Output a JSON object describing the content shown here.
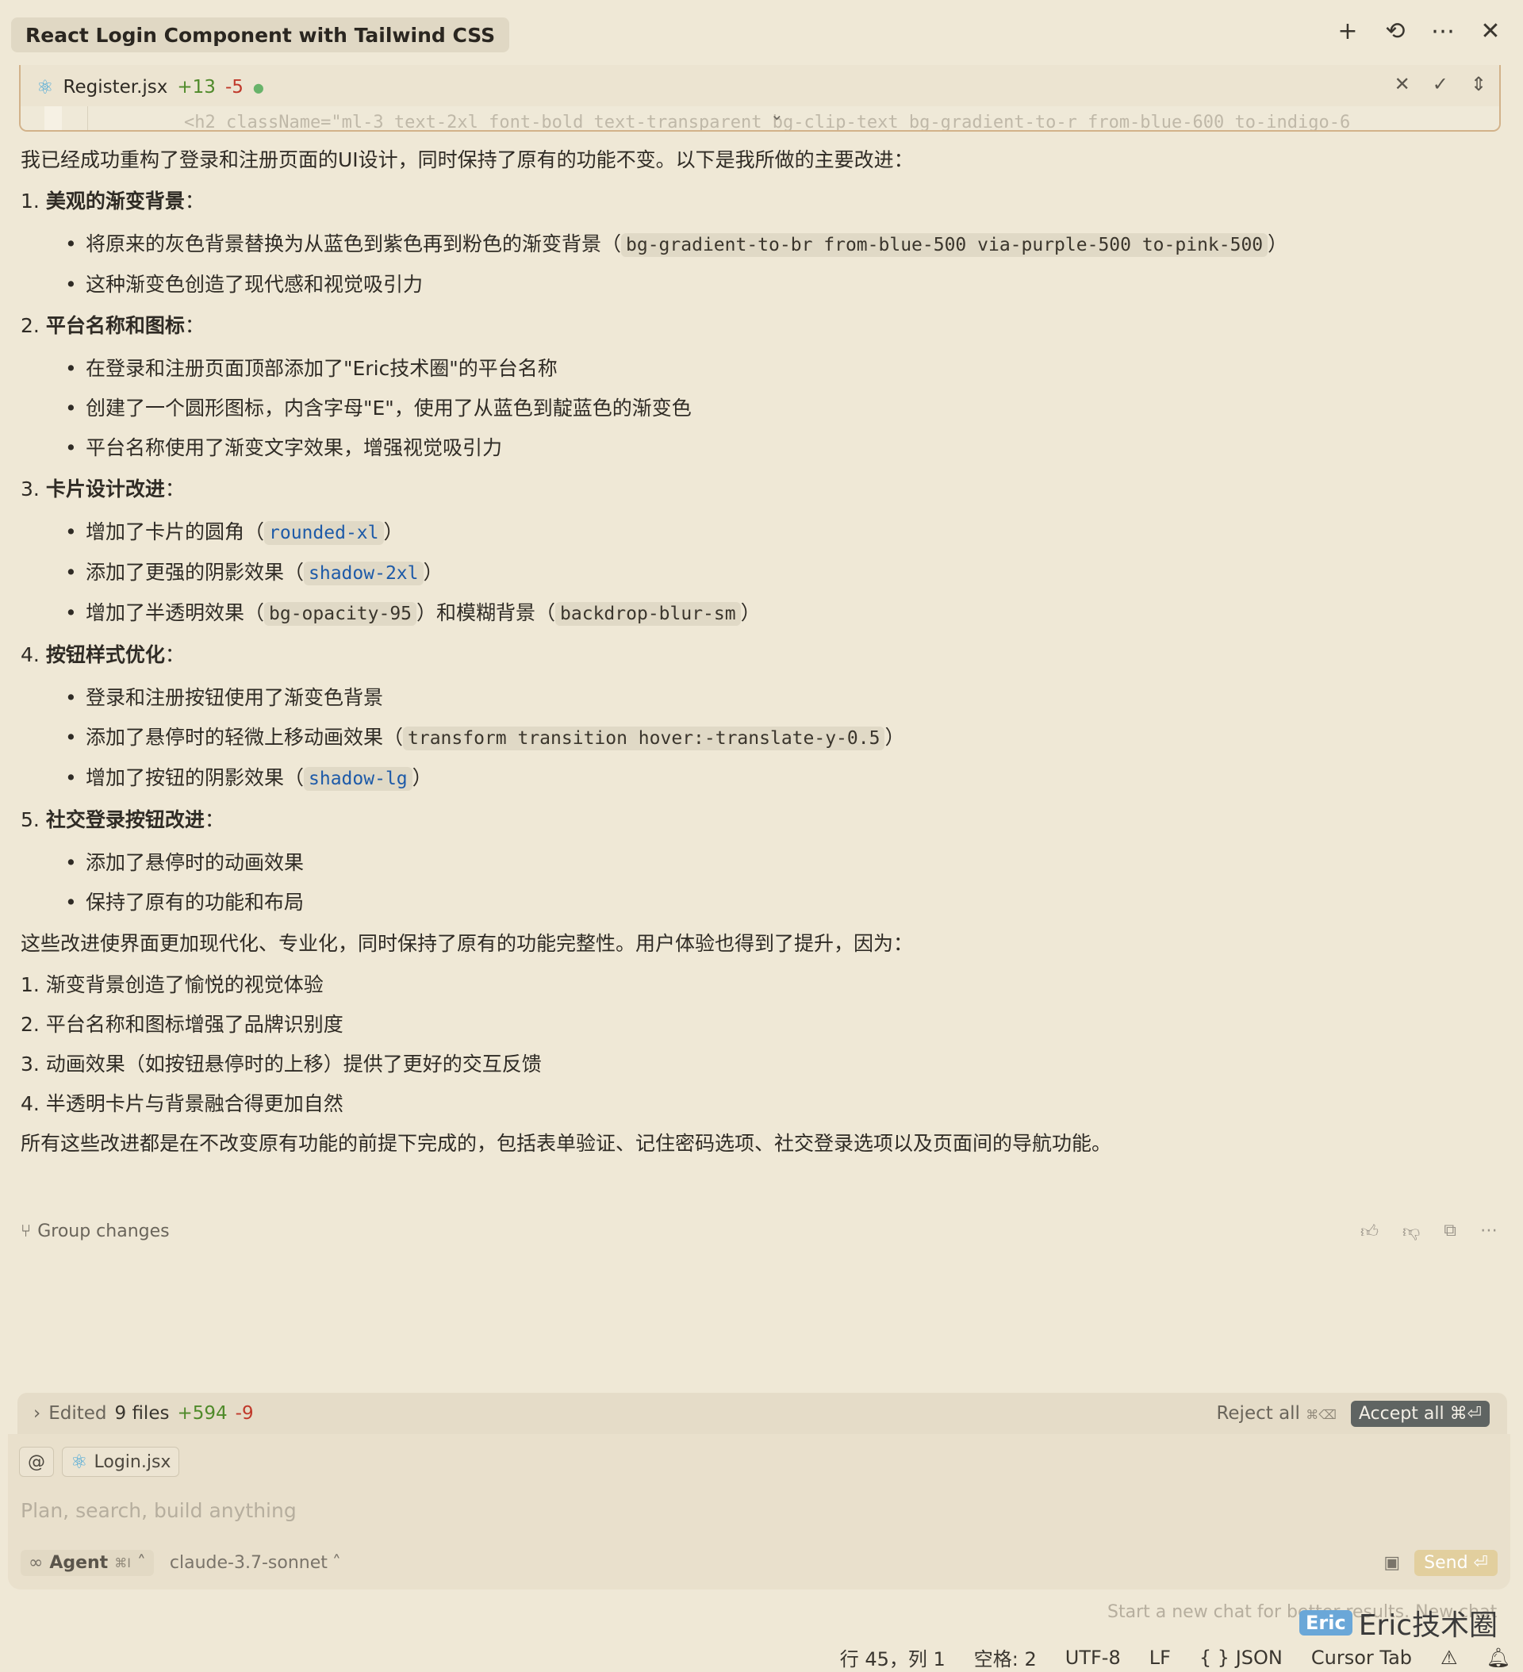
{
  "header": {
    "title": "React Login Component with Tailwind CSS",
    "icons": [
      "plus-icon",
      "history-icon",
      "more-icon",
      "close-icon"
    ]
  },
  "file": {
    "name": "Register.jsx",
    "added": "+13",
    "removed": "-5",
    "code_preview": "<h2 className=\"ml-3 text-2xl font-bold text-transparent bg-clip-text bg-gradient-to-r from-blue-600 to-indigo-6"
  },
  "content": {
    "intro": "我已经成功重构了登录和注册页面的UI设计，同时保持了原有的功能不变。以下是我所做的主要改进：",
    "s1": {
      "num": "1. ",
      "title": "美观的渐变背景",
      "colon": "：",
      "b1_pre": "将原来的灰色背景替换为从蓝色到紫色再到粉色的渐变背景（",
      "b1_code": "bg-gradient-to-br from-blue-500 via-purple-500 to-pink-500",
      "b1_post": "）",
      "b2": "这种渐变色创造了现代感和视觉吸引力"
    },
    "s2": {
      "num": "2. ",
      "title": "平台名称和图标",
      "colon": "：",
      "b1": "在登录和注册页面顶部添加了\"Eric技术圈\"的平台名称",
      "b2": "创建了一个圆形图标，内含字母\"E\"，使用了从蓝色到靛蓝色的渐变色",
      "b3": "平台名称使用了渐变文字效果，增强视觉吸引力"
    },
    "s3": {
      "num": "3. ",
      "title": "卡片设计改进",
      "colon": "：",
      "b1_pre": "增加了卡片的圆角（",
      "b1_code": "rounded-xl",
      "b1_post": "）",
      "b2_pre": "添加了更强的阴影效果（",
      "b2_code": "shadow-2xl",
      "b2_post": "）",
      "b3_pre": "增加了半透明效果（",
      "b3_code1": "bg-opacity-95",
      "b3_mid": "）和模糊背景（",
      "b3_code2": "backdrop-blur-sm",
      "b3_post": "）"
    },
    "s4": {
      "num": "4. ",
      "title": "按钮样式优化",
      "colon": "：",
      "b1": "登录和注册按钮使用了渐变色背景",
      "b2_pre": "添加了悬停时的轻微上移动画效果（",
      "b2_code": "transform transition hover:-translate-y-0.5",
      "b2_post": "）",
      "b3_pre": "增加了按钮的阴影效果（",
      "b3_code": "shadow-lg",
      "b3_post": "）"
    },
    "s5": {
      "num": "5. ",
      "title": "社交登录按钮改进",
      "colon": "：",
      "b1": "添加了悬停时的动画效果",
      "b2": "保持了原有的功能和布局"
    },
    "summary": "这些改进使界面更加现代化、专业化，同时保持了原有的功能完整性。用户体验也得到了提升，因为：",
    "points": [
      "1. 渐变背景创造了愉悦的视觉体验",
      "2. 平台名称和图标增强了品牌识别度",
      "3. 动画效果（如按钮悬停时的上移）提供了更好的交互反馈",
      "4. 半透明卡片与背景融合得更加自然"
    ],
    "closing": "所有这些改进都是在不改变原有功能的前提下完成的，包括表单验证、记住密码选项、社交登录选项以及页面间的导航功能。"
  },
  "group": {
    "label": "Group changes"
  },
  "edited": {
    "label": "Edited",
    "files": "9 files",
    "added": "+594",
    "removed": "-9",
    "reject": "Reject all",
    "reject_key": "⌘⌫",
    "accept": "Accept all ⌘⏎"
  },
  "composer": {
    "at": "@",
    "context_file": "Login.jsx",
    "placeholder": "Plan, search, build anything",
    "agent": "Agent",
    "agent_key": "⌘I",
    "model": "claude-3.7-sonnet",
    "send": "Send"
  },
  "hint": "Start a new chat for better results.  New chat",
  "watermark": {
    "logo": "Eric",
    "text": "Eric技术圈"
  },
  "status": {
    "position": "行 45，列 1",
    "spaces": "空格: 2",
    "encoding": "UTF-8",
    "eol": "LF",
    "language": "{ } JSON",
    "cursor_tab": "Cursor Tab"
  },
  "colors": {
    "background": "#efe8d6",
    "accent_added": "#4f8a2a",
    "accent_removed": "#c0392b",
    "code_blue": "#1d5aa8"
  }
}
